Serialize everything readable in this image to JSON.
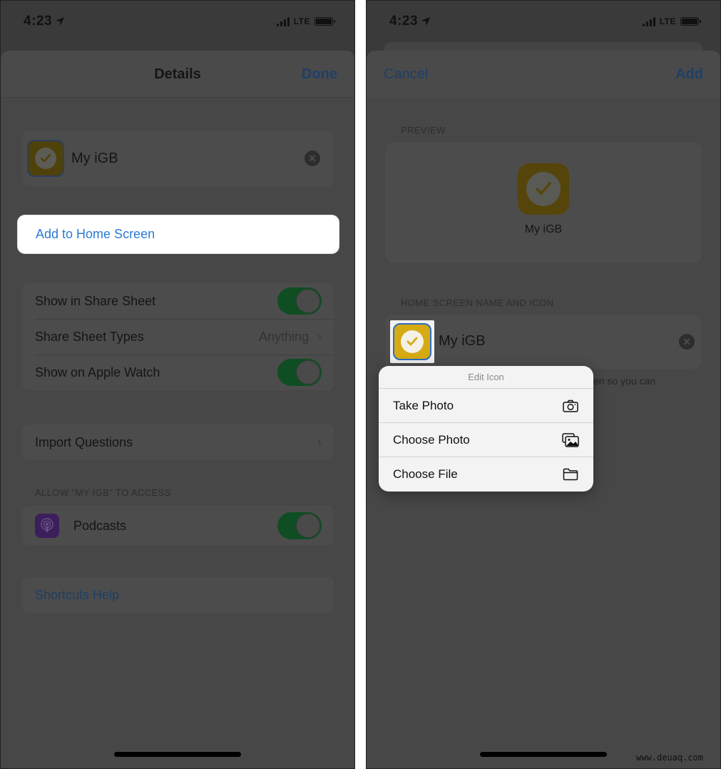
{
  "left": {
    "status": {
      "time": "4:23",
      "network": "LTE"
    },
    "nav": {
      "title": "Details",
      "done": "Done"
    },
    "shortcut": {
      "name": "My iGB"
    },
    "add_home": "Add to Home Screen",
    "settings": [
      {
        "label": "Show in Share Sheet",
        "type": "toggle",
        "on": true
      },
      {
        "label": "Share Sheet Types",
        "type": "link",
        "value": "Anything"
      },
      {
        "label": "Show on Apple Watch",
        "type": "toggle",
        "on": true
      }
    ],
    "import_questions": "Import Questions",
    "access_header": "ALLOW \"MY IGB\" TO ACCESS",
    "access": [
      {
        "label": "Podcasts",
        "icon": "podcasts-icon",
        "on": true
      }
    ],
    "help": "Shortcuts Help"
  },
  "right": {
    "status": {
      "time": "4:23",
      "network": "LTE"
    },
    "nav": {
      "cancel": "Cancel",
      "add": "Add"
    },
    "preview_header": "PREVIEW",
    "preview_name": "My iGB",
    "name_icon_header": "HOME SCREEN NAME AND ICON",
    "name_value": "My iGB",
    "behind_text": "en so you can",
    "popover": {
      "title": "Edit Icon",
      "items": [
        {
          "label": "Take Photo",
          "icon": "camera-icon"
        },
        {
          "label": "Choose Photo",
          "icon": "photos-icon"
        },
        {
          "label": "Choose File",
          "icon": "folder-icon"
        }
      ]
    }
  },
  "watermark": "www.deuaq.com",
  "colors": {
    "accent_blue": "#2a7bd4",
    "toggle_green_dimmed": "#0f4d22",
    "icon_yellow": "#d6aa12",
    "overlay_gray": "#474747"
  }
}
